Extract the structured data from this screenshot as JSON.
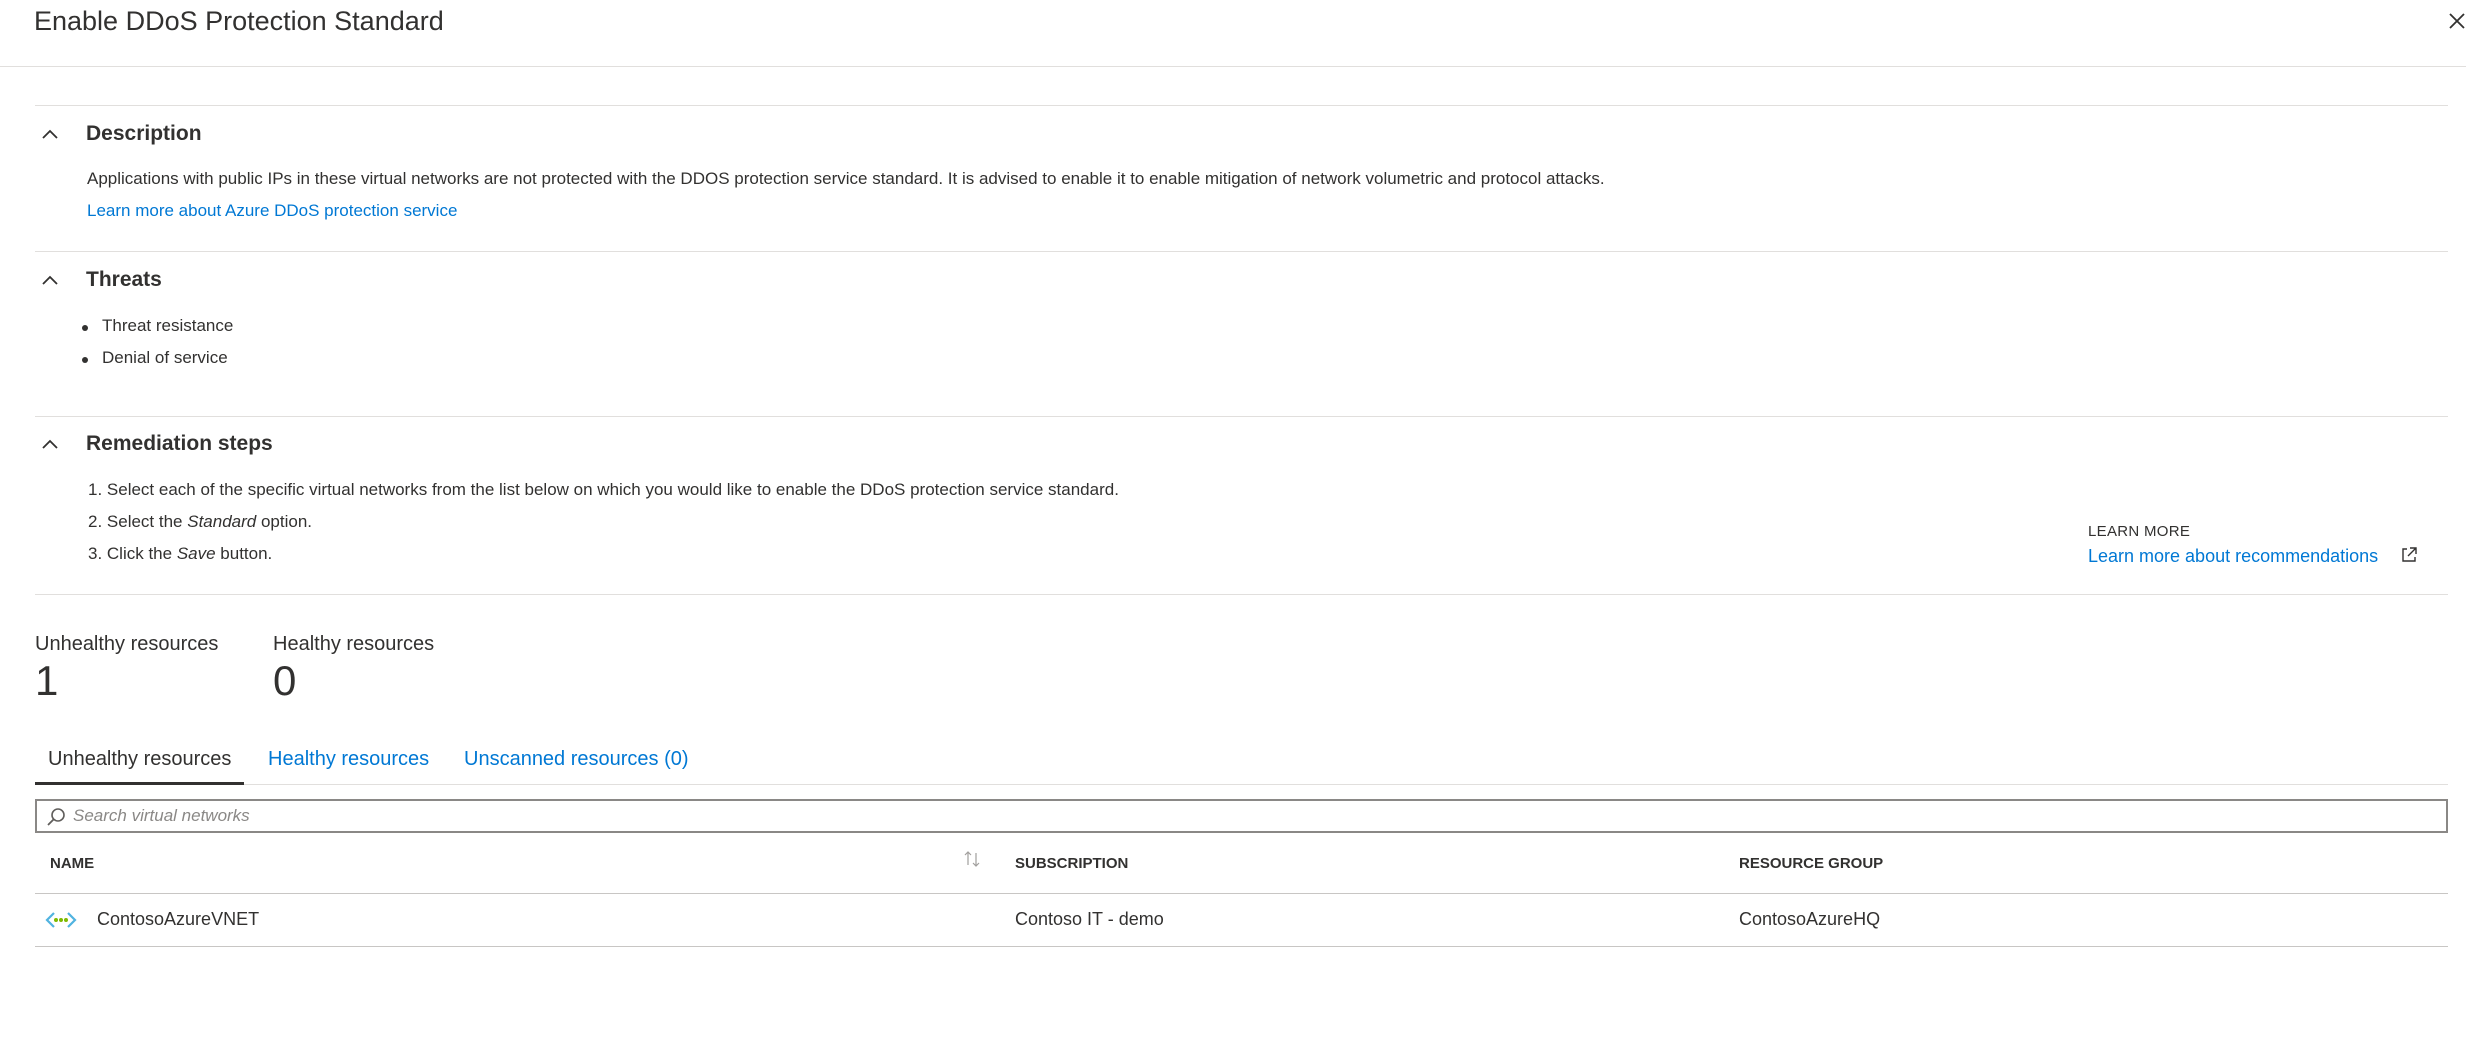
{
  "header": {
    "title": "Enable DDoS Protection Standard",
    "close_icon": "close-icon"
  },
  "sections": {
    "description": {
      "title": "Description",
      "text": "Applications with public IPs in these virtual networks are not protected with the DDOS protection service standard. It is advised to enable it to enable mitigation of network volumetric and protocol attacks.",
      "link": "Learn more about Azure DDoS protection service"
    },
    "threats": {
      "title": "Threats",
      "items": [
        "Threat resistance",
        "Denial of service"
      ]
    },
    "remediation": {
      "title": "Remediation steps",
      "step1": "1. Select each of the specific virtual networks from the list below on which you would like to enable the DDoS protection service standard.",
      "step2_pre": "2. Select the ",
      "step2_em": "Standard",
      "step2_post": " option.",
      "step3_pre": "3. Click the ",
      "step3_em": "Save",
      "step3_post": " button."
    }
  },
  "metrics": {
    "unhealthy_label": "Unhealthy resources",
    "unhealthy_value": "1",
    "healthy_label": "Healthy resources",
    "healthy_value": "0"
  },
  "learn_more": {
    "caption": "LEARN MORE",
    "link": "Learn more about recommendations"
  },
  "tabs": [
    {
      "label": "Unhealthy resources",
      "active": true
    },
    {
      "label": "Healthy resources",
      "active": false
    },
    {
      "label": "Unscanned resources (0)",
      "active": false
    }
  ],
  "search": {
    "placeholder": "Search virtual networks",
    "value": ""
  },
  "table": {
    "columns": [
      "NAME",
      "SUBSCRIPTION",
      "RESOURCE GROUP"
    ],
    "rows": [
      {
        "name": "ContosoAzureVNET",
        "subscription": "Contoso IT - demo",
        "resource_group": "ContosoAzureHQ",
        "icon": "virtual-network-icon"
      }
    ]
  },
  "colors": {
    "accent": "#0078d4",
    "text": "#323130",
    "divider": "#e1dfdd",
    "vnet_icon_blue": "#50b3e0",
    "vnet_icon_green": "#7fba00"
  }
}
